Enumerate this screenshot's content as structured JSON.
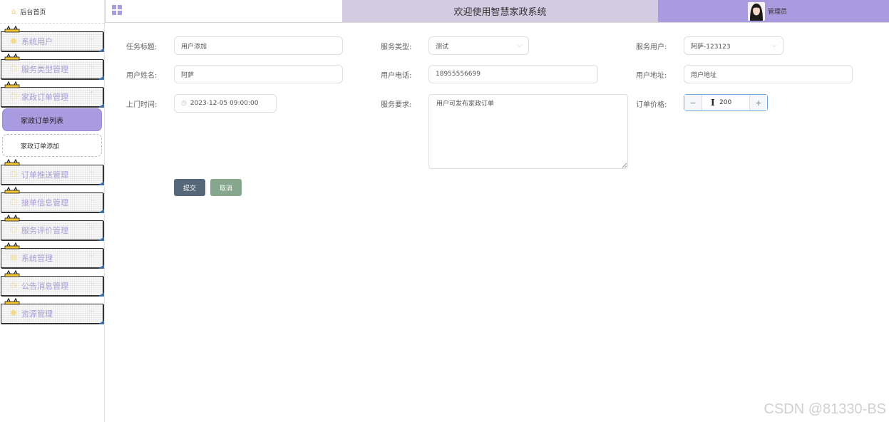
{
  "header": {
    "title": "欢迎使用智慧家政系统",
    "user_name": "管理员",
    "accent": "#a99bdf"
  },
  "sidebar": {
    "home": "后台首页",
    "menus": [
      {
        "label": "系统用户",
        "icon": "user-icon"
      },
      {
        "label": "服务类型管理",
        "icon": "doc-icon"
      },
      {
        "label": "家政订单管理",
        "icon": "doc-icon",
        "open": true,
        "children": [
          "家政订单列表",
          "家政订单添加"
        ]
      },
      {
        "label": "订单推送管理",
        "icon": "doc-icon"
      },
      {
        "label": "接单信息管理",
        "icon": "doc-icon"
      },
      {
        "label": "服务评价管理",
        "icon": "doc-icon"
      },
      {
        "label": "系统管理",
        "icon": "doc-icon"
      },
      {
        "label": "公告消息管理",
        "icon": "clock-icon"
      },
      {
        "label": "资源管理",
        "icon": "cube-icon"
      }
    ]
  },
  "form": {
    "task_title_label": "任务标题:",
    "task_title_value": "用户添加",
    "service_type_label": "服务类型:",
    "service_type_value": "测试",
    "service_user_label": "服务用户:",
    "service_user_value": "阿萨-123123",
    "user_name_label": "用户姓名:",
    "user_name_value": "阿萨",
    "user_phone_label": "用户电话:",
    "user_phone_value": "18955556699",
    "user_address_label": "用户地址:",
    "user_address_value": "用户地址",
    "visit_time_label": "上门时间:",
    "visit_time_value": "2023-12-05 09:00:00",
    "requirement_label": "服务要求:",
    "requirement_value": "用户可发布家政订单",
    "price_label": "订单价格:",
    "price_value": "200",
    "submit": "提交",
    "cancel": "取消"
  },
  "watermark": "CSDN @81330-BS"
}
